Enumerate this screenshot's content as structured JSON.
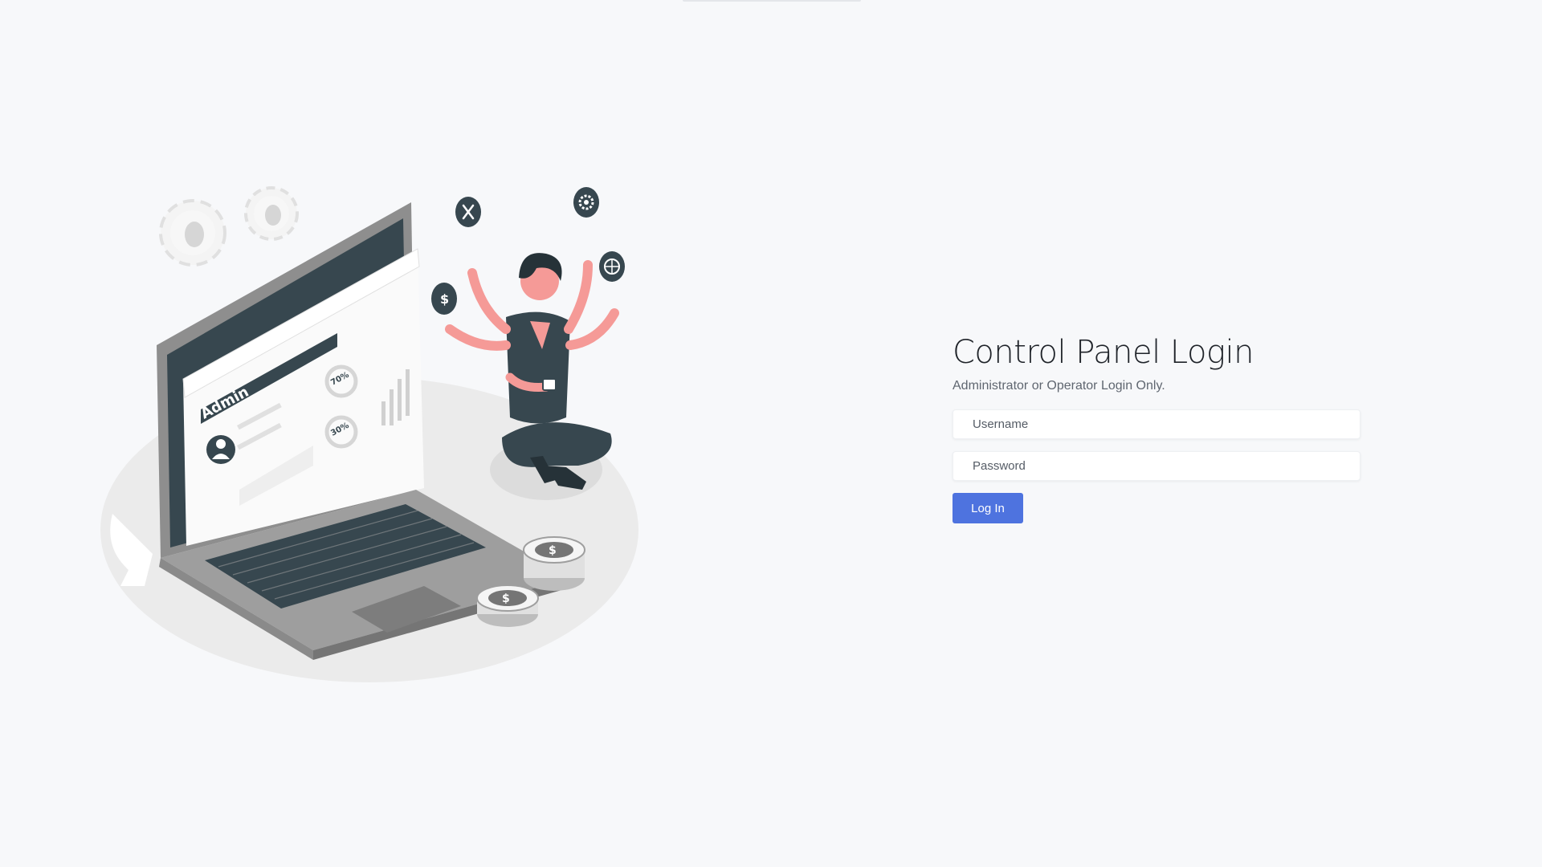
{
  "login": {
    "title": "Control Panel Login",
    "subtitle": "Administrator or Operator Login Only.",
    "username_placeholder": "Username",
    "password_placeholder": "Password",
    "submit_label": "Log In"
  },
  "illustration": {
    "screen_label": "Admin",
    "stat_top": "70%",
    "stat_bottom": "30%",
    "coin_symbol": "$"
  },
  "colors": {
    "background": "#f7f8fa",
    "accent": "#4e73df",
    "dark": "#37474f",
    "skin": "#f59a97"
  }
}
